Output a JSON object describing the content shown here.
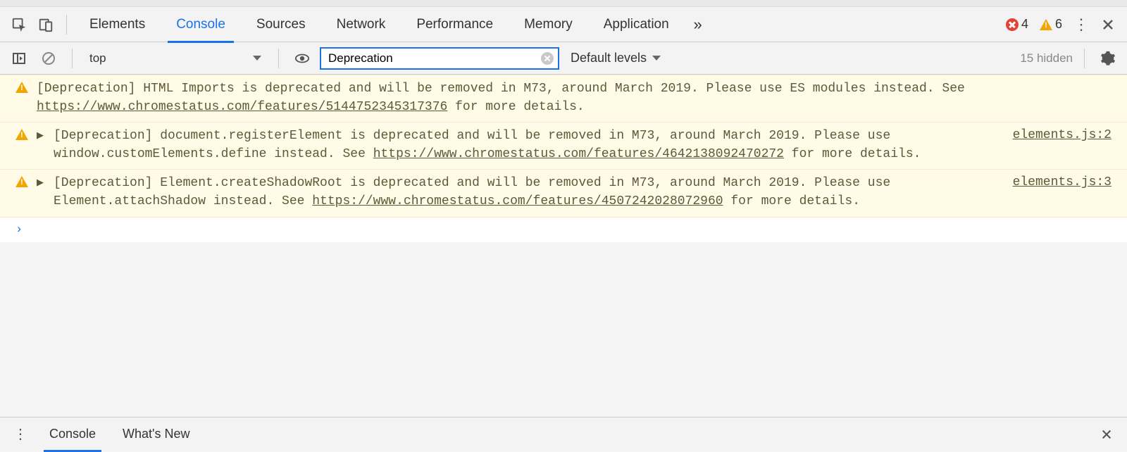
{
  "gutter": {},
  "tabs": {
    "items": [
      "Elements",
      "Console",
      "Sources",
      "Network",
      "Performance",
      "Memory",
      "Application"
    ],
    "active": "Console",
    "overflow_icon": "chevrons-right",
    "errors_count": "4",
    "warnings_count": "6"
  },
  "console_toolbar": {
    "context_label": "top",
    "filter_value": "Deprecation",
    "level_label": "Default levels",
    "hidden_label": "15 hidden"
  },
  "messages": [
    {
      "expandable": false,
      "text_pre": "[Deprecation] HTML Imports is deprecated and will be removed in M73, around March 2019. Please use ES modules instead. See ",
      "link": "https://www.chromestatus.com/features/5144752345317376",
      "text_post": " for more details.",
      "source": ""
    },
    {
      "expandable": true,
      "text_pre": "[Deprecation] document.registerElement is deprecated and will be removed in M73, around March 2019. Please use window.customElements.define instead. See ",
      "link": "https://www.chromestatus.com/features/4642138092470272",
      "text_post": " for more details.",
      "source": "elements.js:2"
    },
    {
      "expandable": true,
      "text_pre": "[Deprecation] Element.createShadowRoot is deprecated and will be removed in M73, around March 2019. Please use Element.attachShadow instead. See ",
      "link": "https://www.chromestatus.com/features/4507242028072960",
      "text_post": " for more details.",
      "source": "elements.js:3"
    }
  ],
  "prompt": "›",
  "drawer": {
    "tabs": [
      "Console",
      "What's New"
    ],
    "active": "Console"
  }
}
